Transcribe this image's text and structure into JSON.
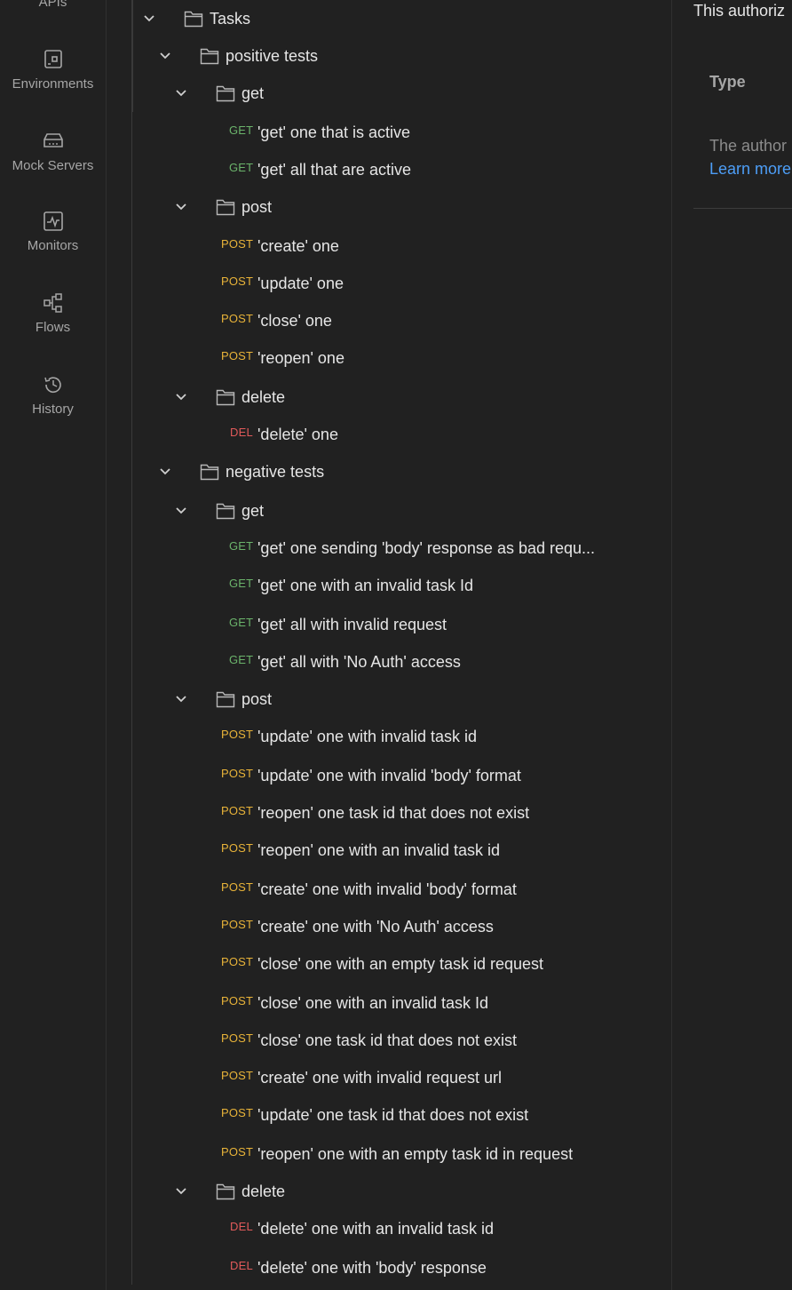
{
  "nav": {
    "apis": "APIs",
    "environments": "Environments",
    "mock_servers": "Mock Servers",
    "monitors": "Monitors",
    "flows": "Flows",
    "history": "History"
  },
  "tree": {
    "root": "Tasks",
    "positive": "positive tests",
    "negative": "negative tests",
    "folders": {
      "get": "get",
      "post": "post",
      "delete": "delete"
    },
    "methods": {
      "get": "GET",
      "post": "POST",
      "del": "DEL"
    },
    "positive_get": [
      "'get' one that is active",
      "'get' all that are active"
    ],
    "positive_post": [
      "'create' one",
      "'update' one",
      "'close' one",
      "'reopen' one"
    ],
    "positive_delete": [
      "'delete' one"
    ],
    "negative_get": [
      "'get' one sending 'body' response as bad requ...",
      "'get' one with an invalid task Id",
      "'get' all with invalid request",
      "'get' all with 'No Auth' access"
    ],
    "negative_post": [
      "'update' one with invalid task id",
      "'update' one with invalid 'body' format",
      "'reopen' one task id that does not exist",
      "'reopen' one with an invalid task id",
      "'create' one with invalid 'body' format",
      "'create' one with 'No Auth' access",
      "'close' one with an empty task id request",
      "'close' one with an invalid task Id",
      "'close' one task id that does not exist",
      "'create' one with invalid request url",
      "'update' one task id that does not exist",
      "'reopen' one with an empty task id in request"
    ],
    "negative_delete": [
      "'delete' one with an invalid task id",
      "'delete' one with 'body' response"
    ]
  },
  "right": {
    "top_text": "This authoriz",
    "type_label": "Type",
    "desc": "The author",
    "learn_more": "Learn more"
  },
  "colors": {
    "get": "#6bb36b",
    "post": "#e8b339",
    "del": "#e05a5a",
    "link": "#4d9ef7"
  }
}
